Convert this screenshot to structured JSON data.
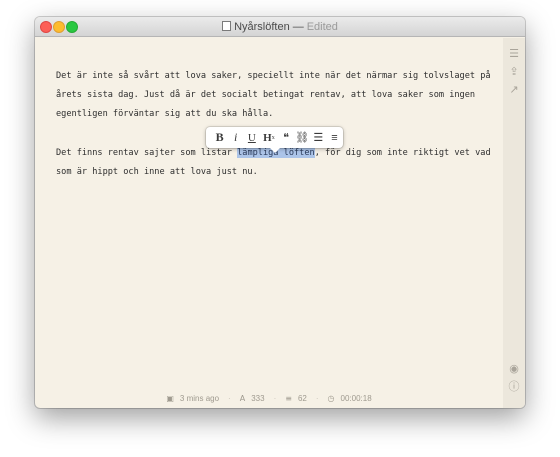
{
  "window": {
    "title": "Nyårslöften",
    "title_dash": "—",
    "status": "Edited"
  },
  "content": {
    "paragraph1": "Det är inte så svårt att lova saker, speciellt inte när det närmar sig tolvslaget på\nårets sista dag. Just då är det socialt betingat rentav, att lova saker som ingen\negentligen förväntar sig att du ska hålla.",
    "paragraph2_before": "Det finns rentav sajter som listar ",
    "paragraph2_selected": "lämpliga löften",
    "paragraph2_after": ", för dig som inte riktigt vet vad\nsom är hippt och inne att lova just nu."
  },
  "toolbar": {
    "bold": "B",
    "italic": "i",
    "underline": "U",
    "heading": "H",
    "heading_sub": "x",
    "quote": "❝",
    "link": "⛓",
    "list": "☰",
    "align": "≡"
  },
  "sidebar": {
    "icons": [
      "list-icon",
      "share-icon",
      "export-icon",
      "preview-eye-icon",
      "help-icon"
    ]
  },
  "statusbar": {
    "saved": "3 mins ago",
    "characters": "333",
    "words": "62",
    "timer": "00:00:18"
  },
  "colors": {
    "background": "#f6f1e6",
    "selection": "#acc4e8",
    "sidebar": "#ece7dc"
  }
}
